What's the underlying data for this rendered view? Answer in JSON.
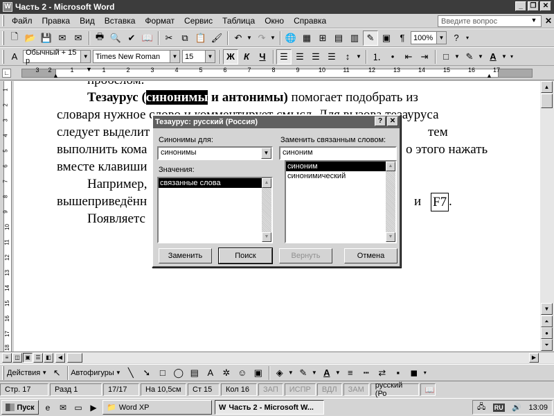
{
  "window": {
    "title": "Часть 2 - Microsoft Word",
    "app_icon": "W"
  },
  "menu": {
    "items": [
      "Файл",
      "Правка",
      "Вид",
      "Вставка",
      "Формат",
      "Сервис",
      "Таблица",
      "Окно",
      "Справка"
    ],
    "help_placeholder": "Введите вопрос"
  },
  "toolbar_standard": {
    "zoom": "100%"
  },
  "toolbar_format": {
    "style": "Обычный + 15 р",
    "font": "Times New Roman",
    "size": "15"
  },
  "ruler": {
    "marks": [
      "3",
      "2",
      "1",
      "1",
      "2",
      "3",
      "4",
      "5",
      "6",
      "7",
      "8",
      "9",
      "10",
      "11",
      "12",
      "13",
      "14",
      "15",
      "16",
      "17"
    ]
  },
  "vruler": {
    "marks": [
      "1",
      "2",
      "3",
      "4",
      "5",
      "6",
      "7",
      "8",
      "9",
      "10",
      "11",
      "12",
      "13",
      "14",
      "15",
      "16",
      "17",
      "18"
    ]
  },
  "document": {
    "line0": "пробелом.",
    "p1_term": "Тезаурус (",
    "p1_highlight": "синонимы",
    "p1_rest_bold": " и антонимы)",
    "p1_rest": " помогает подобрать из",
    "line2": "словаря нужное слово и комментирует смысл. Для вызова тезауруса",
    "line3_left": "следует выделит",
    "line3_right": "тем",
    "line4_left": "выполнить кома",
    "line4_right": "о этого нажать",
    "line5_left": "вместе клавиши",
    "line6_left": "Например,",
    "line6_right": "в",
    "line7_left": "вышеприведённ",
    "line7_and": "и",
    "line7_key": "F7",
    "line7_dot": ".",
    "line8_left": "Появляетс"
  },
  "dialog": {
    "title": "Тезаурус: русский (Россия)",
    "synonyms_for_label": "Синонимы для:",
    "synonyms_for_value": "синонимы",
    "meanings_label": "Значения:",
    "meanings": [
      "связанные слова"
    ],
    "replace_with_label": "Заменить связанным словом:",
    "replace_with_value": "синоним",
    "replace_list": [
      "синоним",
      "синонимический"
    ],
    "buttons": {
      "replace": "Заменить",
      "search": "Поиск",
      "back": "Вернуть",
      "cancel": "Отмена"
    }
  },
  "drawbar": {
    "actions": "Действия",
    "autoshapes": "Автофигуры"
  },
  "status": {
    "page": "Стр. 17",
    "section": "Разд 1",
    "pages": "17/17",
    "at": "На 10,5см",
    "line": "Ст 15",
    "col": "Кол 16",
    "rec": "ЗАП",
    "trk": "ИСПР",
    "ext": "ВДЛ",
    "ovr": "ЗАМ",
    "lang": "русский (Ро"
  },
  "taskbar": {
    "start": "Пуск",
    "tasks": [
      "Word XP",
      "Часть 2 - Microsoft W..."
    ],
    "lang": "RU",
    "clock": "13:09"
  }
}
